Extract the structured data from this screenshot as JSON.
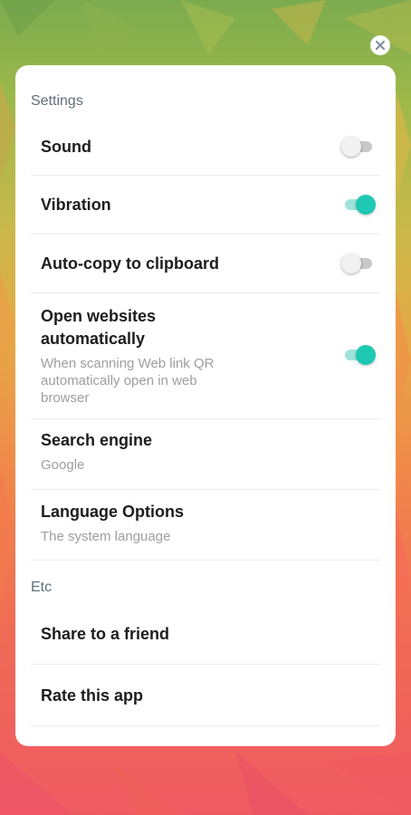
{
  "close_icon": "close-icon",
  "settings": {
    "header": "Settings",
    "sound": {
      "label": "Sound",
      "enabled": false
    },
    "vibration": {
      "label": "Vibration",
      "enabled": true
    },
    "auto_copy": {
      "label": "Auto-copy to clipboard",
      "enabled": false
    },
    "open_websites": {
      "label_line1": "Open websites",
      "label_line2": "automatically",
      "desc_line1": "When scanning Web link QR",
      "desc_line2": "automatically open in web",
      "desc_line3": "browser",
      "enabled": true
    },
    "search_engine": {
      "label": "Search engine",
      "value": "Google"
    },
    "language": {
      "label": "Language Options",
      "value": "The system language"
    }
  },
  "etc": {
    "header": "Etc",
    "share_label": "Share to a friend",
    "rate_label": "Rate this app"
  },
  "colors": {
    "toggle_on": "#1fc8b3",
    "toggle_on_track": "#9fe3da",
    "toggle_off_track": "#c9c9c9"
  }
}
